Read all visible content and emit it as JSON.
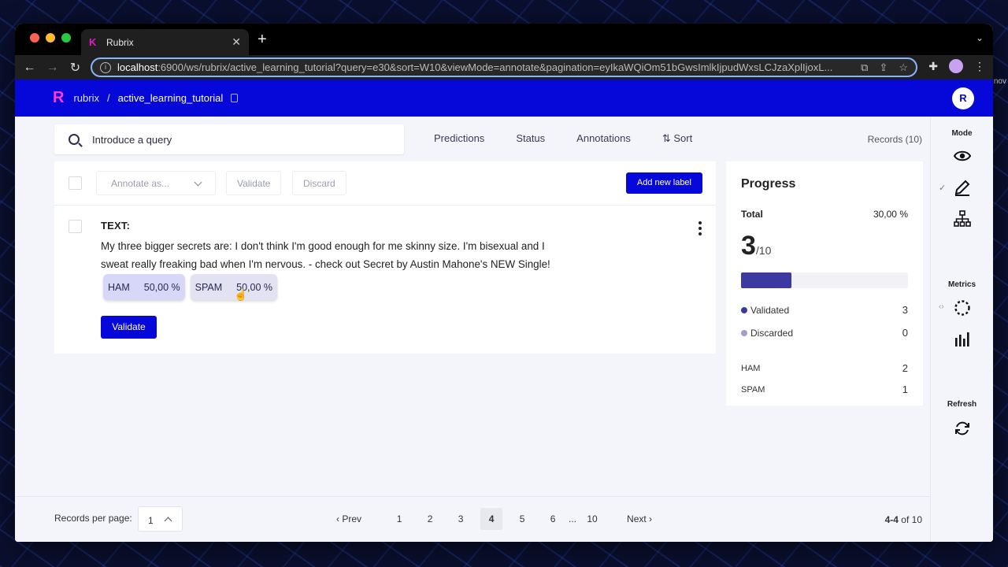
{
  "browser": {
    "tab_title": "Rubrix",
    "url_host": "localhost",
    "url_rest": ":6900/ws/rubrix/active_learning_tutorial?query=e30&sort=W10&viewMode=annotate&pagination=eyIkaWQiOm51bGwsImlkIjpudWxsLCJzaXplIjoxL..."
  },
  "app": {
    "logo": "R",
    "workspace": "rubrix",
    "separator": "/",
    "dataset": "active_learning_tutorial",
    "user_initial": "R"
  },
  "search": {
    "placeholder": "Introduce a query"
  },
  "filters": [
    "Predictions",
    "Status",
    "Annotations",
    "⇅ Sort"
  ],
  "records_count": "Records (10)",
  "toolbar": {
    "annotate_as": "Annotate as...",
    "validate": "Validate",
    "discard": "Discard",
    "add_label": "Add new label"
  },
  "record": {
    "field_label": "TEXT:",
    "text": "My three bigger secrets are: I don't think I'm good enough for me skinny size. I'm bisexual and I sweat really freaking bad when I'm nervous. - check out Secret by Austin Mahone's NEW Single!",
    "labels": [
      {
        "name": "HAM",
        "score": "50,00 %"
      },
      {
        "name": "SPAM",
        "score": "50,00 %"
      }
    ],
    "validate": "Validate"
  },
  "progress": {
    "title": "Progress",
    "total_label": "Total",
    "total_percent": "30,00 %",
    "count": "3",
    "of": "/10",
    "fraction": 0.3,
    "validated_label": "Validated",
    "validated": "3",
    "discarded_label": "Discarded",
    "discarded": "0",
    "labels": [
      {
        "name": "HAM",
        "count": "2"
      },
      {
        "name": "SPAM",
        "count": "1"
      }
    ],
    "colors": {
      "fill": "#3c3aa0",
      "validated": "#3c3aa0",
      "discarded": "#a09dc7"
    }
  },
  "sidebar": {
    "mode": "Mode",
    "metrics": "Metrics",
    "refresh": "Refresh"
  },
  "footer": {
    "records_per_page_label": "Records per page:",
    "records_per_page": "1",
    "prev": "Prev",
    "next": "Next",
    "pages": [
      "1",
      "2",
      "3",
      "4",
      "5",
      "6",
      "...",
      "10"
    ],
    "current_page": "4",
    "range_bold": "4-4",
    "range_rest": " of 10"
  },
  "edge_text": "nov"
}
